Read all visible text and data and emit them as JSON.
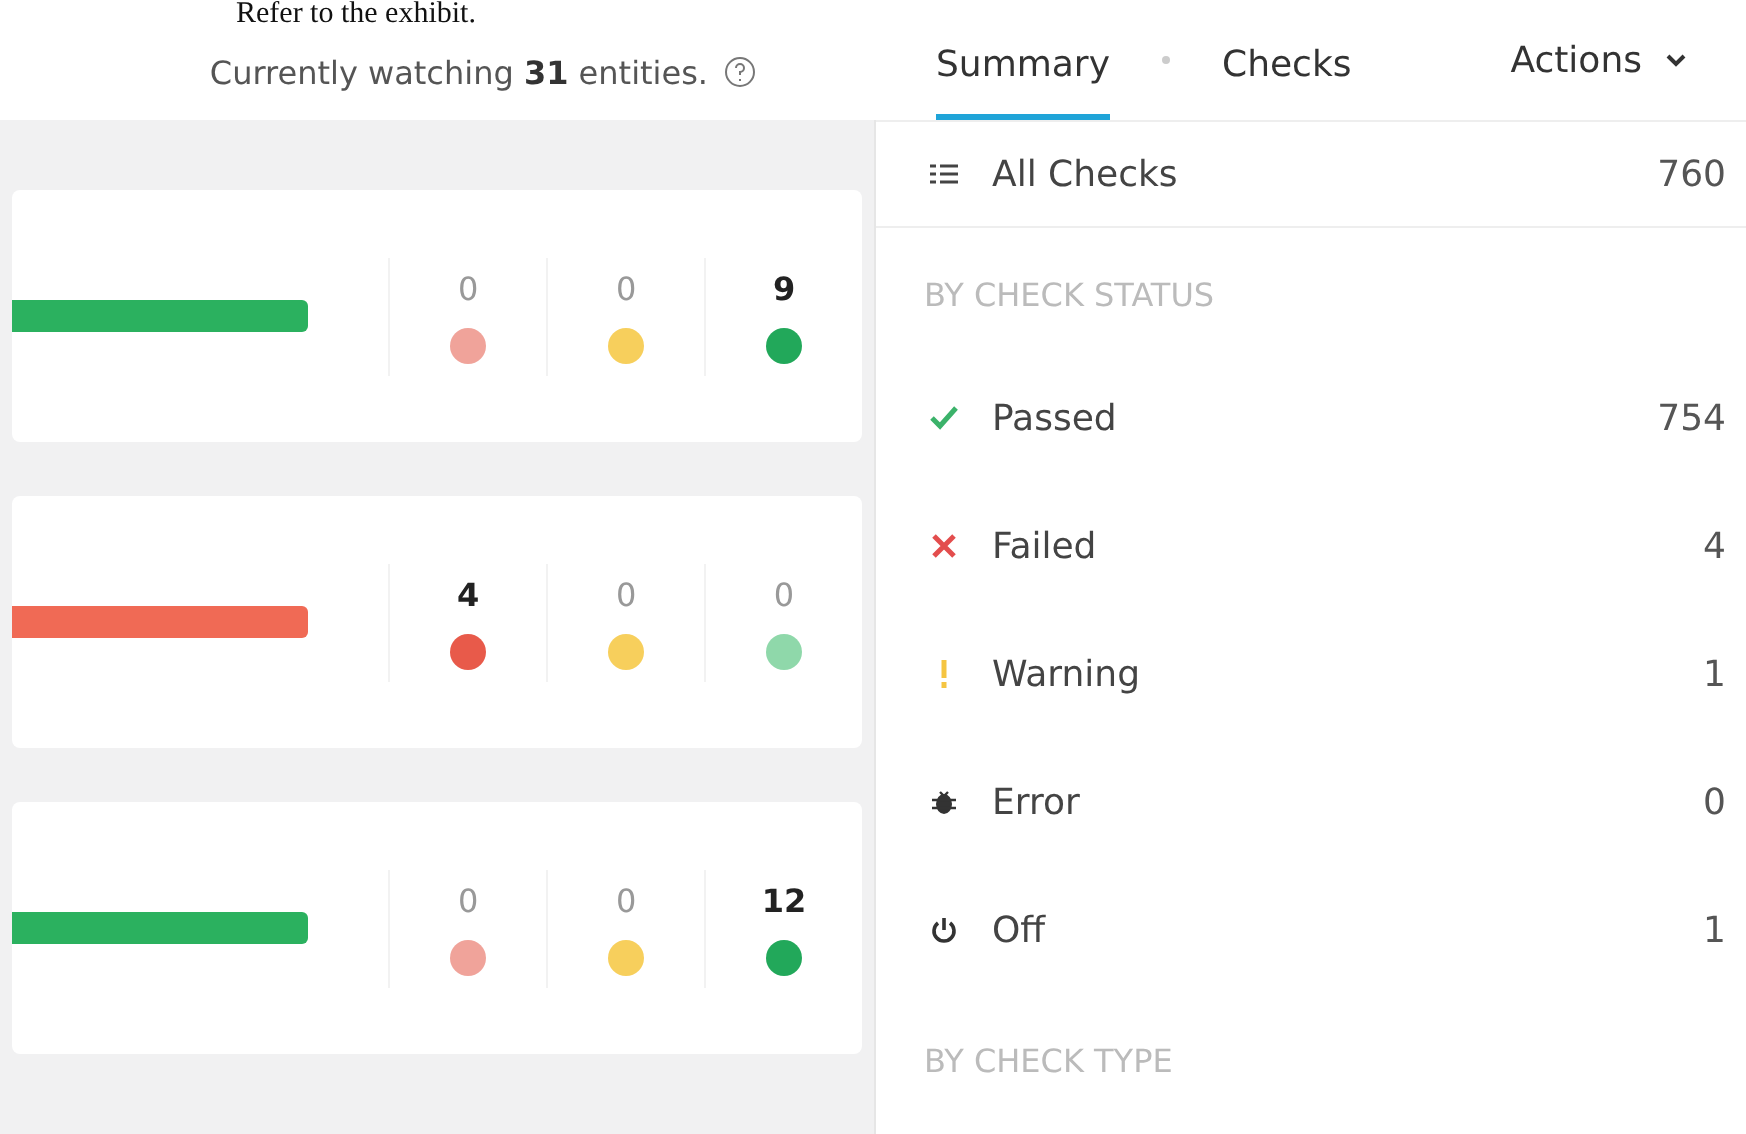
{
  "exhibit_caption": "Refer to the exhibit.",
  "header": {
    "text": "Currently watching **31** entities."
  },
  "cards": [
    {
      "color": "#2bb15f",
      "counts": [
        {
          "value": "0",
          "color": "#f0a39a",
          "emphasized": false
        },
        {
          "value": "0",
          "color": "#f7cf5c",
          "emphasized": false
        },
        {
          "value": "9",
          "color": "#22a85a",
          "emphasized": true
        }
      ]
    },
    {
      "color": "#f06a55",
      "counts": [
        {
          "value": "4",
          "color": "#e85a4a",
          "emphasized": true
        },
        {
          "value": "0",
          "color": "#f7cf5c",
          "emphasized": false
        },
        {
          "value": "0",
          "color": "#8fd8aa",
          "emphasized": false
        }
      ]
    },
    {
      "color": "#2bb15f",
      "counts": [
        {
          "value": "0",
          "color": "#f0a39a",
          "emphasized": false
        },
        {
          "value": "0",
          "color": "#f7cf5c",
          "emphasized": false
        },
        {
          "value": "12",
          "color": "#22a85a",
          "emphasized": true
        }
      ]
    }
  ],
  "tabs": [
    {
      "label": "Summary",
      "selected": true
    },
    {
      "label": "Checks",
      "selected": false
    }
  ],
  "actions_menu": {
    "label": "Actions"
  },
  "all_checks": {
    "label": "All Checks",
    "count": "760"
  },
  "status_section": {
    "heading": "BY CHECK STATUS",
    "items": [
      {
        "kind": "passed",
        "label": "Passed",
        "count": "754"
      },
      {
        "kind": "failed",
        "label": "Failed",
        "count": "4"
      },
      {
        "kind": "warning",
        "label": "Warning",
        "count": "1"
      },
      {
        "kind": "error",
        "label": "Error",
        "count": "0"
      },
      {
        "kind": "off",
        "label": "Off",
        "count": "1"
      }
    ]
  },
  "type_section": {
    "heading": "BY CHECK TYPE"
  }
}
